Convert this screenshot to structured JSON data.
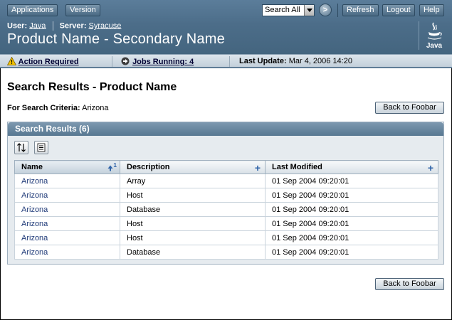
{
  "masthead": {
    "applications_label": "Applications",
    "version_label": "Version",
    "search_select_value": "Search All",
    "go_label": ">",
    "refresh_label": "Refresh",
    "logout_label": "Logout",
    "help_label": "Help",
    "user_label": "User:",
    "user_value": "Java",
    "server_label": "Server:",
    "server_value": "Syracuse",
    "product_name": "Product Name - Secondary Name",
    "logo_text": "Java"
  },
  "statusbar": {
    "action_required": "Action Required",
    "jobs_running": "Jobs Running: 4",
    "last_update_label": "Last Update:",
    "last_update_value": "Mar 4, 2006 14:20"
  },
  "page": {
    "title": "Search Results - Product Name",
    "criteria_label": "For Search Criteria:",
    "criteria_value": "Arizona",
    "back_label": "Back to Foobar"
  },
  "table": {
    "title": "Search Results (6)",
    "columns": [
      "Name",
      "Description",
      "Last Modified"
    ],
    "sort_indicator": "1",
    "rows": [
      {
        "name": "Arizona",
        "description": "Array",
        "modified": "01 Sep 2004 09:20:01"
      },
      {
        "name": "Arizona",
        "description": "Host",
        "modified": "01 Sep 2004 09:20:01"
      },
      {
        "name": "Arizona",
        "description": "Database",
        "modified": "01 Sep 2004 09:20:01"
      },
      {
        "name": "Arizona",
        "description": "Host",
        "modified": "01 Sep 2004 09:20:01"
      },
      {
        "name": "Arizona",
        "description": "Host",
        "modified": "01 Sep 2004 09:20:01"
      },
      {
        "name": "Arizona",
        "description": "Database",
        "modified": "01 Sep 2004 09:20:01"
      }
    ]
  },
  "colors": {
    "masthead": "#4c6d89",
    "statusbar": "#c3d0db",
    "link": "#1f3a78",
    "sort_icon": "#2f63a8"
  }
}
